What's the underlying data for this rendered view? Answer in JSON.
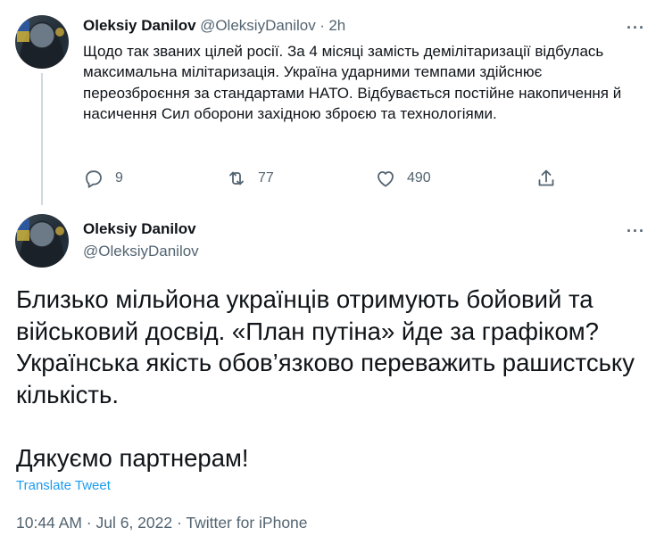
{
  "tweet1": {
    "author_name": "Oleksiy Danilov",
    "handle": "@OleksiyDanilov",
    "separator": "·",
    "time": "2h",
    "more": "···",
    "text": "Щодо так званих цілей росії. За 4 місяці замість демілітаризації відбулась максимальна мілітаризація. Україна ударними темпами здійснює переозброєння за стандартами НАТО. Відбувається постійне накопичення й насичення Сил оборони західною зброєю та технологіями.",
    "replies": "9",
    "retweets": "77",
    "likes": "490"
  },
  "tweet2": {
    "author_name": "Oleksiy Danilov",
    "handle": "@OleksiyDanilov",
    "more": "···",
    "paragraphs": [
      "Близько мільйона українців отримують бойовий та військовий досвід. «План путіна» йде за графіком? Українська якість обов’язково переважить рашистську кількість.",
      "Дякуємо партнерам!"
    ],
    "translate_label": "Translate Tweet",
    "timestamp": "10:44 AM · Jul 6, 2022 · Twitter for iPhone"
  },
  "colors": {
    "text": "#0f1419",
    "muted": "#536471",
    "link": "#1d9bf0",
    "thread_line": "#cfd9de"
  },
  "icons": [
    "reply-icon",
    "retweet-icon",
    "like-icon",
    "share-icon",
    "more-icon"
  ]
}
